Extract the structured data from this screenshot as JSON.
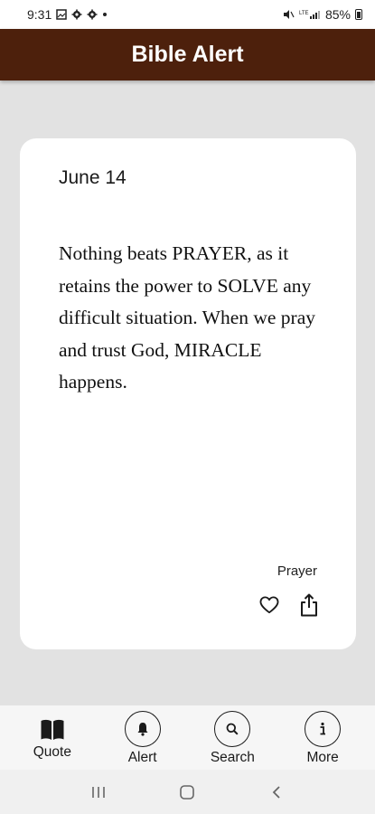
{
  "status_bar": {
    "time": "9:31",
    "battery": "85%"
  },
  "app_bar": {
    "title": "Bible Alert"
  },
  "card": {
    "date": "June 14",
    "quote": "Nothing beats PRAYER, as it retains the power to SOLVE any difficult situation. When we pray and trust God, MIRACLE happens.",
    "tag": "Prayer"
  },
  "bottom_nav": {
    "items": [
      {
        "label": "Quote",
        "icon": "book-icon"
      },
      {
        "label": "Alert",
        "icon": "bell-icon"
      },
      {
        "label": "Search",
        "icon": "search-icon"
      },
      {
        "label": "More",
        "icon": "info-icon"
      }
    ]
  },
  "colors": {
    "app_bar": "#4d200c",
    "background": "#e2e2e2",
    "card": "#ffffff"
  }
}
